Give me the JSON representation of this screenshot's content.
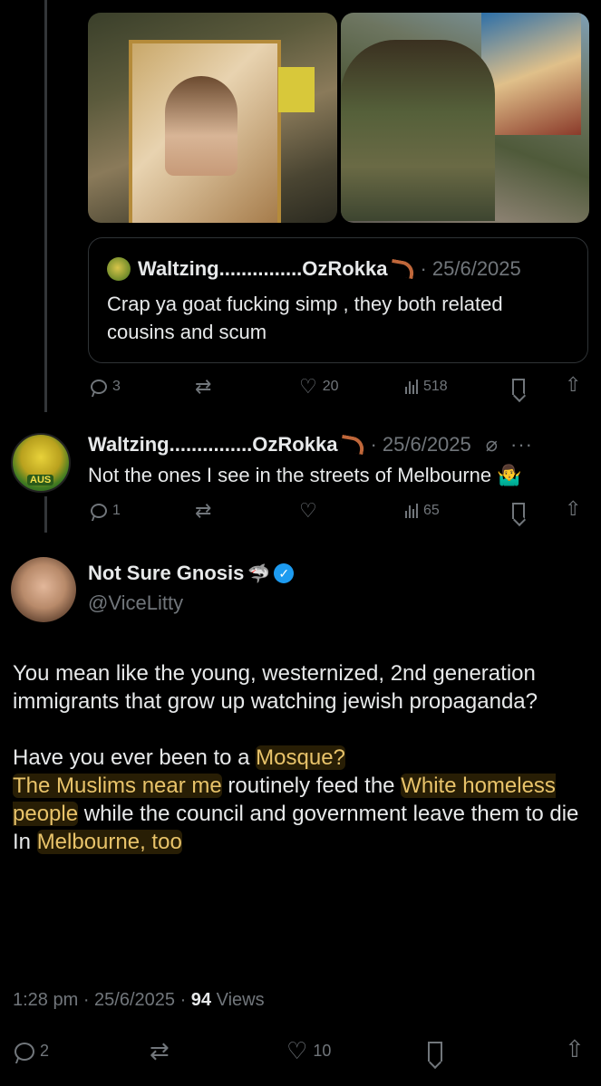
{
  "quoted_tweet": {
    "author_name": "Waltzing...............OzRokka",
    "date": "· 25/6/2025",
    "text": "Crap ya goat fucking simp , they both related cousins and scum"
  },
  "tweet1_actions": {
    "replies": "3",
    "retweets": "",
    "likes": "20",
    "views": "518"
  },
  "reply": {
    "author_name": "Waltzing...............OzRokka",
    "date": "· 25/6/2025",
    "text": "Not the ones I see in the streets of Melbourne",
    "emoji": "🤷‍♂️",
    "more": "···",
    "avatar_badge": "AUS",
    "actions": {
      "replies": "1",
      "views": "65"
    }
  },
  "main_tweet": {
    "display_name": "Not Sure Gnosis",
    "handle": "@ViceLitty",
    "para1": "You mean like the young, westernized, 2nd generation immigrants that grow up watching jewish propaganda?",
    "line1_pre": "Have you ever been to a ",
    "line1_hl": "Mosque?",
    "line2_hl1": "The Muslims near me",
    "line2_mid": " routinely feed the ",
    "line2_hl2": "White homeless people",
    "line2_post": " while the council and government leave them to die",
    "line3_pre": "In ",
    "line3_hl": "Melbourne, too",
    "time": "1:28 pm · 25/6/2025 · ",
    "views_count": "94",
    "views_label": " Views",
    "actions": {
      "replies": "2",
      "likes": "10"
    }
  },
  "colors": {
    "accent": "#1d9bf0",
    "highlight": "#e8c36a",
    "muted": "#71767b",
    "text": "#e7e9ea"
  },
  "icons": [
    "reply-icon",
    "retweet-icon",
    "like-icon",
    "views-icon",
    "bookmark-icon",
    "share-icon",
    "verified-icon",
    "shark-icon",
    "boomerang-icon",
    "edit-icon"
  ]
}
